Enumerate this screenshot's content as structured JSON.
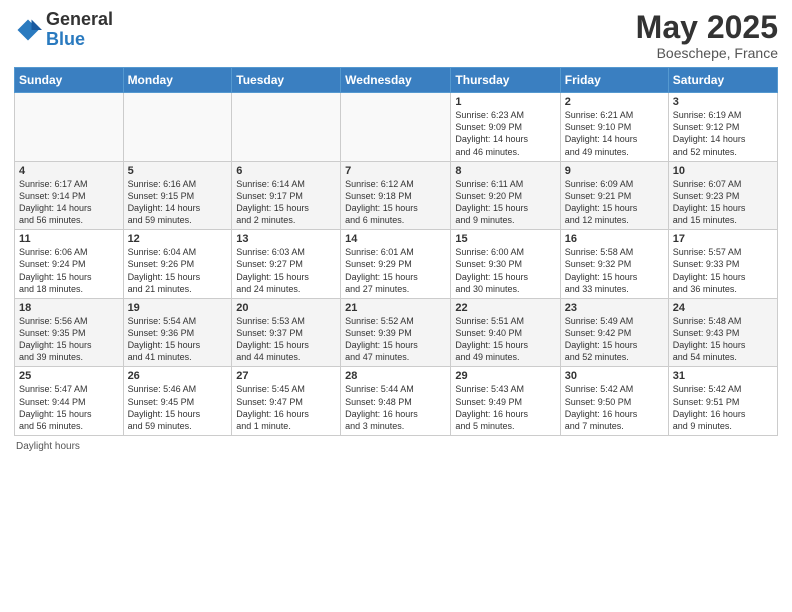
{
  "header": {
    "logo_general": "General",
    "logo_blue": "Blue",
    "main_title": "May 2025",
    "subtitle": "Boeschepe, France"
  },
  "days_of_week": [
    "Sunday",
    "Monday",
    "Tuesday",
    "Wednesday",
    "Thursday",
    "Friday",
    "Saturday"
  ],
  "weeks": [
    [
      {
        "day": "",
        "info": ""
      },
      {
        "day": "",
        "info": ""
      },
      {
        "day": "",
        "info": ""
      },
      {
        "day": "",
        "info": ""
      },
      {
        "day": "1",
        "info": "Sunrise: 6:23 AM\nSunset: 9:09 PM\nDaylight: 14 hours\nand 46 minutes."
      },
      {
        "day": "2",
        "info": "Sunrise: 6:21 AM\nSunset: 9:10 PM\nDaylight: 14 hours\nand 49 minutes."
      },
      {
        "day": "3",
        "info": "Sunrise: 6:19 AM\nSunset: 9:12 PM\nDaylight: 14 hours\nand 52 minutes."
      }
    ],
    [
      {
        "day": "4",
        "info": "Sunrise: 6:17 AM\nSunset: 9:14 PM\nDaylight: 14 hours\nand 56 minutes."
      },
      {
        "day": "5",
        "info": "Sunrise: 6:16 AM\nSunset: 9:15 PM\nDaylight: 14 hours\nand 59 minutes."
      },
      {
        "day": "6",
        "info": "Sunrise: 6:14 AM\nSunset: 9:17 PM\nDaylight: 15 hours\nand 2 minutes."
      },
      {
        "day": "7",
        "info": "Sunrise: 6:12 AM\nSunset: 9:18 PM\nDaylight: 15 hours\nand 6 minutes."
      },
      {
        "day": "8",
        "info": "Sunrise: 6:11 AM\nSunset: 9:20 PM\nDaylight: 15 hours\nand 9 minutes."
      },
      {
        "day": "9",
        "info": "Sunrise: 6:09 AM\nSunset: 9:21 PM\nDaylight: 15 hours\nand 12 minutes."
      },
      {
        "day": "10",
        "info": "Sunrise: 6:07 AM\nSunset: 9:23 PM\nDaylight: 15 hours\nand 15 minutes."
      }
    ],
    [
      {
        "day": "11",
        "info": "Sunrise: 6:06 AM\nSunset: 9:24 PM\nDaylight: 15 hours\nand 18 minutes."
      },
      {
        "day": "12",
        "info": "Sunrise: 6:04 AM\nSunset: 9:26 PM\nDaylight: 15 hours\nand 21 minutes."
      },
      {
        "day": "13",
        "info": "Sunrise: 6:03 AM\nSunset: 9:27 PM\nDaylight: 15 hours\nand 24 minutes."
      },
      {
        "day": "14",
        "info": "Sunrise: 6:01 AM\nSunset: 9:29 PM\nDaylight: 15 hours\nand 27 minutes."
      },
      {
        "day": "15",
        "info": "Sunrise: 6:00 AM\nSunset: 9:30 PM\nDaylight: 15 hours\nand 30 minutes."
      },
      {
        "day": "16",
        "info": "Sunrise: 5:58 AM\nSunset: 9:32 PM\nDaylight: 15 hours\nand 33 minutes."
      },
      {
        "day": "17",
        "info": "Sunrise: 5:57 AM\nSunset: 9:33 PM\nDaylight: 15 hours\nand 36 minutes."
      }
    ],
    [
      {
        "day": "18",
        "info": "Sunrise: 5:56 AM\nSunset: 9:35 PM\nDaylight: 15 hours\nand 39 minutes."
      },
      {
        "day": "19",
        "info": "Sunrise: 5:54 AM\nSunset: 9:36 PM\nDaylight: 15 hours\nand 41 minutes."
      },
      {
        "day": "20",
        "info": "Sunrise: 5:53 AM\nSunset: 9:37 PM\nDaylight: 15 hours\nand 44 minutes."
      },
      {
        "day": "21",
        "info": "Sunrise: 5:52 AM\nSunset: 9:39 PM\nDaylight: 15 hours\nand 47 minutes."
      },
      {
        "day": "22",
        "info": "Sunrise: 5:51 AM\nSunset: 9:40 PM\nDaylight: 15 hours\nand 49 minutes."
      },
      {
        "day": "23",
        "info": "Sunrise: 5:49 AM\nSunset: 9:42 PM\nDaylight: 15 hours\nand 52 minutes."
      },
      {
        "day": "24",
        "info": "Sunrise: 5:48 AM\nSunset: 9:43 PM\nDaylight: 15 hours\nand 54 minutes."
      }
    ],
    [
      {
        "day": "25",
        "info": "Sunrise: 5:47 AM\nSunset: 9:44 PM\nDaylight: 15 hours\nand 56 minutes."
      },
      {
        "day": "26",
        "info": "Sunrise: 5:46 AM\nSunset: 9:45 PM\nDaylight: 15 hours\nand 59 minutes."
      },
      {
        "day": "27",
        "info": "Sunrise: 5:45 AM\nSunset: 9:47 PM\nDaylight: 16 hours\nand 1 minute."
      },
      {
        "day": "28",
        "info": "Sunrise: 5:44 AM\nSunset: 9:48 PM\nDaylight: 16 hours\nand 3 minutes."
      },
      {
        "day": "29",
        "info": "Sunrise: 5:43 AM\nSunset: 9:49 PM\nDaylight: 16 hours\nand 5 minutes."
      },
      {
        "day": "30",
        "info": "Sunrise: 5:42 AM\nSunset: 9:50 PM\nDaylight: 16 hours\nand 7 minutes."
      },
      {
        "day": "31",
        "info": "Sunrise: 5:42 AM\nSunset: 9:51 PM\nDaylight: 16 hours\nand 9 minutes."
      }
    ]
  ],
  "footer": {
    "daylight_hours": "Daylight hours"
  }
}
